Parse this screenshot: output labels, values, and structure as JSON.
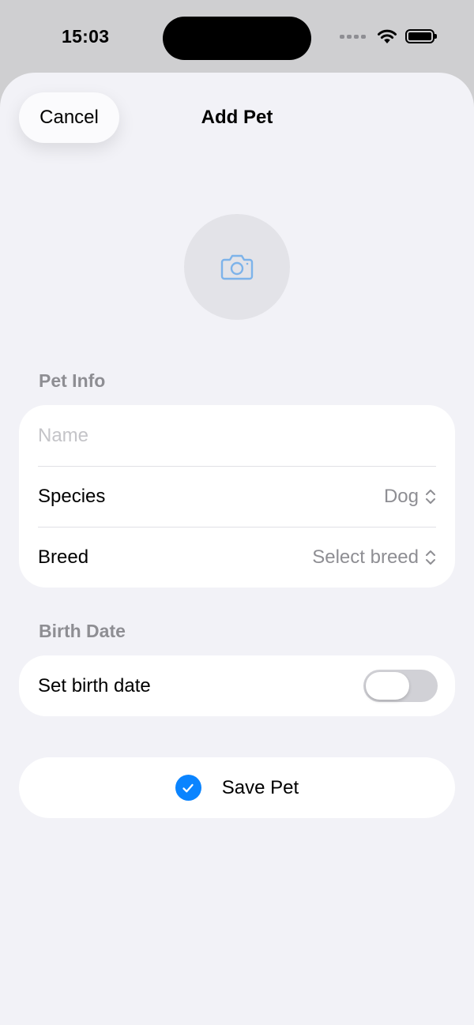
{
  "status_bar": {
    "time": "15:03",
    "icons": [
      "signal-dots-icon",
      "wifi-icon",
      "battery-icon"
    ]
  },
  "nav": {
    "cancel_label": "Cancel",
    "title": "Add Pet"
  },
  "photo_picker": {
    "icon": "camera-icon"
  },
  "pet_info": {
    "header": "Pet Info",
    "name_placeholder": "Name",
    "name_value": "",
    "species_label": "Species",
    "species_value": "Dog",
    "breed_label": "Breed",
    "breed_value": "Select breed"
  },
  "birth_date": {
    "header": "Birth Date",
    "toggle_label": "Set birth date",
    "toggle_on": false
  },
  "save": {
    "label": "Save Pet",
    "icon": "checkmark-circle-icon"
  },
  "colors": {
    "accent": "#0a84ff",
    "background": "#f2f2f7",
    "secondary_text": "#8e8e93"
  }
}
